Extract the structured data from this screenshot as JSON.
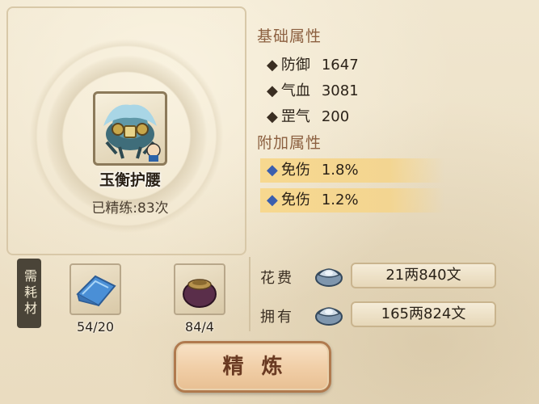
{
  "item": {
    "name": "玉衡护腰",
    "refine_count": "已精练:83次",
    "icon": "armor-belt-icon"
  },
  "base_attributes": {
    "title": "基础属性",
    "rows": [
      {
        "name": "防御",
        "value": "1647"
      },
      {
        "name": "气血",
        "value": "3081"
      },
      {
        "name": "罡气",
        "value": "200"
      }
    ]
  },
  "extra_attributes": {
    "title": "附加属性",
    "rows": [
      {
        "name": "免伤",
        "value": "1.8%"
      },
      {
        "name": "免伤",
        "value": "1.2%"
      }
    ]
  },
  "materials": {
    "label": "需耗材",
    "items": [
      {
        "icon": "blue-cloth-icon",
        "count": "54/20"
      },
      {
        "icon": "pouch-icon",
        "count": "84/4"
      }
    ]
  },
  "costs": {
    "spend_label": "花费",
    "spend_value": "21两840文",
    "own_label": "拥有",
    "own_value": "165两824文",
    "currency_icon": "silver-ingot-icon"
  },
  "refine_button": {
    "label": "精炼"
  }
}
